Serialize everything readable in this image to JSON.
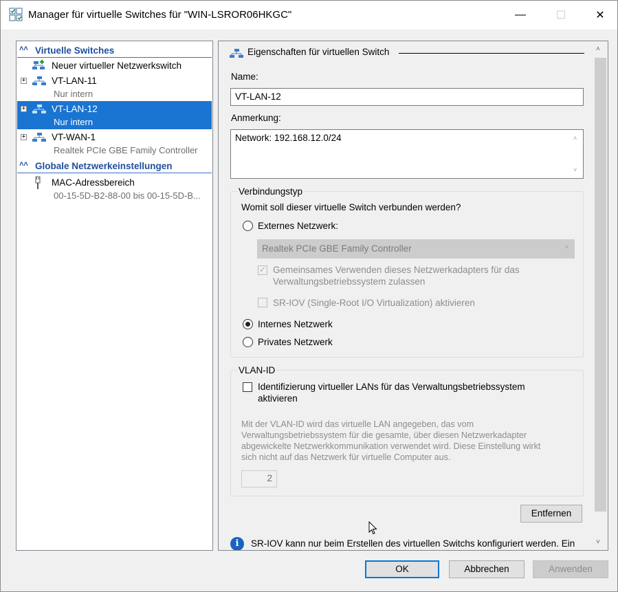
{
  "window": {
    "title": "Manager für virtuelle Switches für \"WIN-LSROR06HKGC\"",
    "controls": {
      "minimize": "—",
      "maximize": "☐",
      "close": "✕"
    }
  },
  "left_pane": {
    "section_switches": "Virtuelle Switches",
    "new_switch": "Neuer virtueller Netzwerkswitch",
    "switches": [
      {
        "name": "VT-LAN-11",
        "sub": "Nur intern"
      },
      {
        "name": "VT-LAN-12",
        "sub": "Nur intern"
      },
      {
        "name": "VT-WAN-1",
        "sub": "Realtek PCIe GBE Family Controller"
      }
    ],
    "section_global": "Globale Netzwerkeinstellungen",
    "mac_range": {
      "name": "MAC-Adressbereich",
      "sub": "00-15-5D-B2-88-00 bis 00-15-5D-B..."
    }
  },
  "properties": {
    "group_title": "Eigenschaften für virtuellen Switch",
    "name_label": "Name:",
    "name_value": "VT-LAN-12",
    "note_label": "Anmerkung:",
    "note_value": "Network: 192.168.12.0/24",
    "connection": {
      "legend": "Verbindungstyp",
      "question": "Womit soll dieser virtuelle Switch verbunden werden?",
      "external_label": "Externes Netzwerk:",
      "adapter_value": "Realtek PCIe GBE Family Controller",
      "share_line1": "Gemeinsames Verwenden dieses Netzwerkadapters für das",
      "share_line2": "Verwaltungsbetriebssystem zulassen",
      "sriov_label": "SR-IOV (Single-Root I/O Virtualization) aktivieren",
      "internal_label": "Internes Netzwerk",
      "private_label": "Privates Netzwerk",
      "selected": "internal"
    },
    "vlan": {
      "legend": "VLAN-ID",
      "enable_line1": "Identifizierung virtueller LANs für das Verwaltungsbetriebssystem",
      "enable_line2": "aktivieren",
      "desc_line1": "Mit der VLAN-ID wird das virtuelle LAN angegeben, das vom",
      "desc_line2": "Verwaltungsbetriebssystem für die gesamte, über diesen Netzwerkadapter",
      "desc_line3": "abgewickelte Netzwerkkommunikation verwendet wird. Diese Einstellung wirkt",
      "desc_line4": "sich nicht auf das Netzwerk für virtuelle Computer aus.",
      "vlan_value": "2"
    },
    "remove_button": "Entfernen",
    "info_text": "SR-IOV kann nur beim Erstellen des virtuellen Switchs konfiguriert werden. Ein"
  },
  "footer": {
    "ok": "OK",
    "cancel": "Abbrechen",
    "apply": "Anwenden"
  },
  "colors": {
    "selection": "#1a74d2",
    "section_header": "#1f4e9c",
    "info_icon": "#1a63c0"
  }
}
